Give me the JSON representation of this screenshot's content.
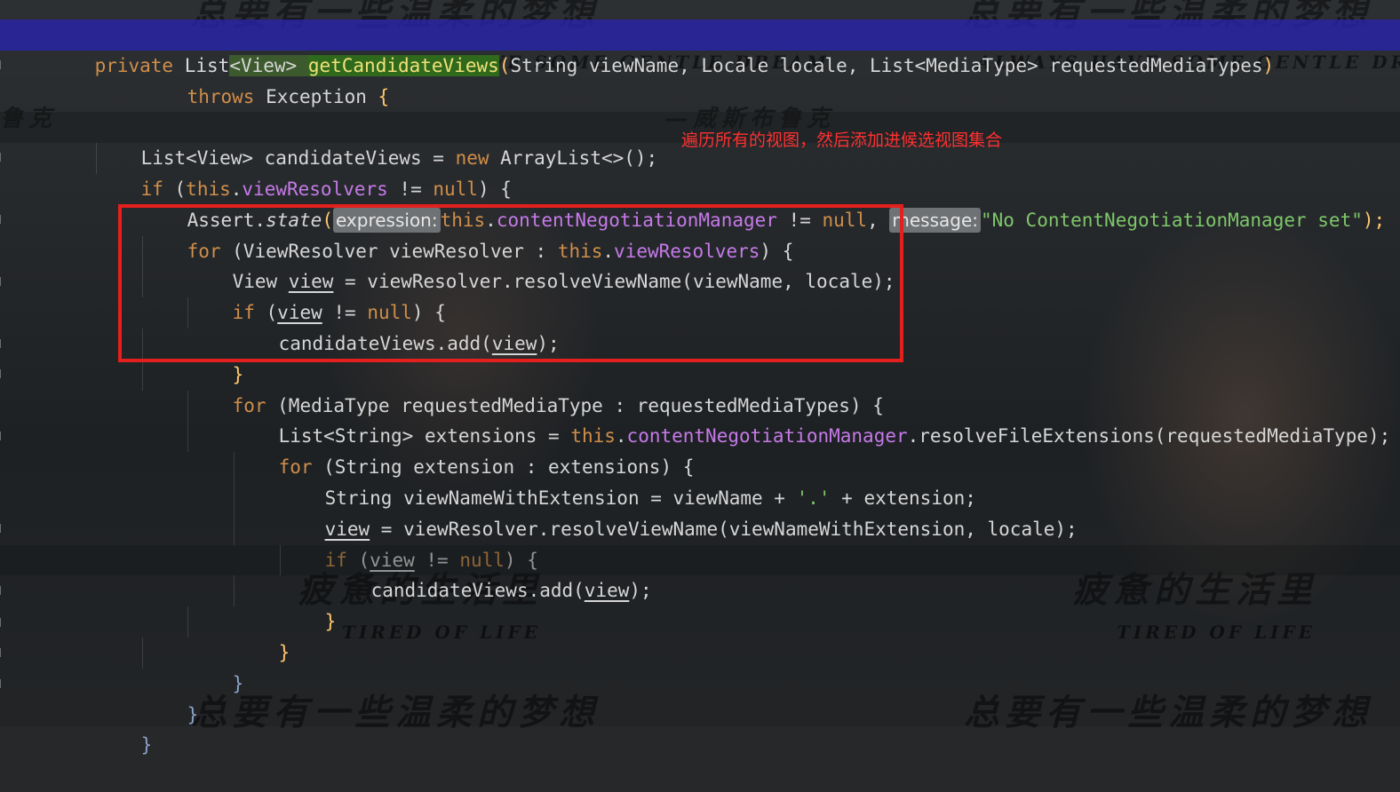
{
  "editor": {
    "lines": [
      [
        "private ",
        "List",
        "<",
        "View",
        "> ",
        "getCandidateViews",
        "(",
        "String viewName, Locale locale, List<MediaType> requestedMediaTypes",
        ")"
      ],
      [
        "throws",
        " Exception ",
        "{"
      ],
      [
        ""
      ],
      [
        "List<View> candidateViews = ",
        "new",
        " ArrayList<>();"
      ],
      [
        "if",
        " (",
        "this",
        ".",
        "viewResolvers",
        " != ",
        "null",
        ") {"
      ],
      [
        "Assert.",
        "state",
        "(",
        "expression:",
        "this",
        ".",
        "contentNegotiationManager",
        " != ",
        "null",
        ", ",
        "message:",
        "\"No ContentNegotiationManager set\"",
        ");"
      ],
      [
        "for",
        " (ViewResolver viewResolver : ",
        "this",
        ".",
        "viewResolvers",
        ") {"
      ],
      [
        "View ",
        "view",
        " = viewResolver.resolveViewName(viewName, locale);"
      ],
      [
        "if",
        " (",
        "view",
        " != ",
        "null",
        ") {"
      ],
      [
        "candidateViews.add(",
        "view",
        ");"
      ],
      [
        "}"
      ],
      [
        "for",
        " (MediaType requestedMediaType : requestedMediaTypes) {"
      ],
      [
        "List<String> extensions = ",
        "this",
        ".",
        "contentNegotiationManager",
        ".resolveFileExtensions(requestedMediaType);"
      ],
      [
        "for",
        " (String extension : extensions) {"
      ],
      [
        "String viewNameWithExtension = viewName + ",
        "'.'",
        " + extension;"
      ],
      [
        "view",
        " = viewResolver.resolveViewName(viewNameWithExtension, locale);"
      ],
      [
        "if",
        " (",
        "view",
        " != ",
        "null",
        ") {"
      ],
      [
        "candidateViews.add(",
        "view",
        ");"
      ],
      [
        "}"
      ],
      [
        "}"
      ],
      [
        "}"
      ],
      [
        "}"
      ],
      [
        "}"
      ]
    ]
  },
  "annotation": {
    "text": "遍历所有的视图，然后添加进候选视图集合"
  },
  "watermark": {
    "cn_dream": "总要有一些温柔的梦想",
    "en_dream": "ALWAYS HAVE SOME GENTLE DREAM",
    "cn_tired": "疲惫的生活里",
    "en_tired": "TIRED OF LIFE",
    "author": "—威斯布鲁克",
    "author_left": "鲁克"
  },
  "colors": {
    "keyword": "#cf8e4a",
    "field": "#c57ae8",
    "string": "#7ec76a",
    "method_highlight": "#2f6a1c",
    "current_line": "#2824aa",
    "annotation": "#ff3030",
    "red_box": "#e3201d"
  }
}
